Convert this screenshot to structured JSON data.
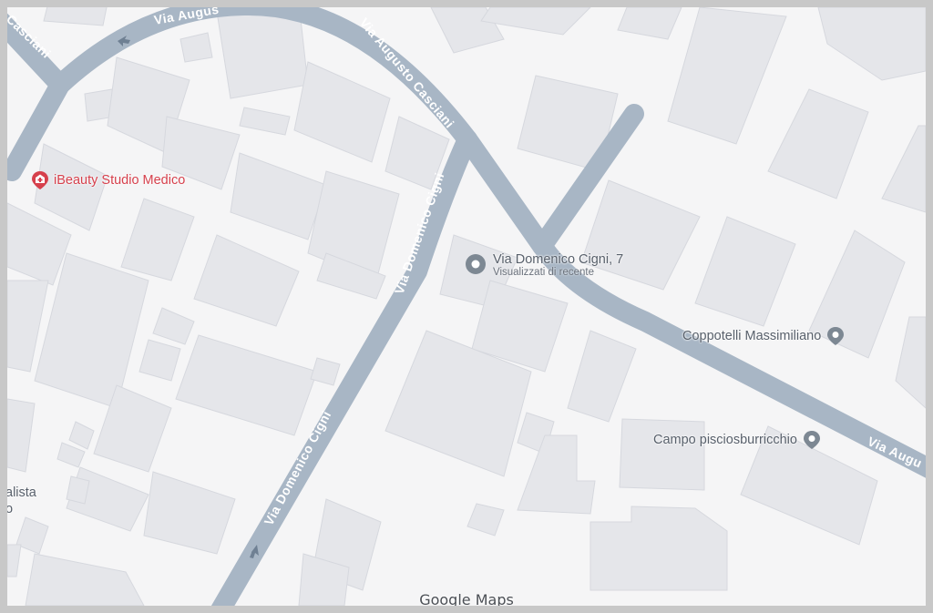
{
  "map": {
    "streets": {
      "via_augusto_casciani_top": "Via Augus",
      "via_augusto_casciani_left": "Casciani",
      "via_augusto_casciani_diag": "Via Augusto Casciani",
      "via_domenico_cigni_upper": "Via Domenico Cigni",
      "via_domenico_cigni_lower": "Via Domenico Cigni",
      "via_augusto_right": "Via Augu"
    },
    "places": {
      "ibeauty": {
        "name": "iBeauty Studio Medico",
        "icon": "medical-pin-icon",
        "color": "#d6404c"
      },
      "selected": {
        "name": "Via Domenico Cigni, 7",
        "subtitle": "Visualizzati di recente",
        "icon": "location-pin-icon"
      },
      "coppotelli": {
        "name": "Coppotelli Massimiliano",
        "icon": "location-pin-icon"
      },
      "campo": {
        "name": "Campo pisciosburricchio",
        "icon": "location-pin-icon"
      },
      "partial_left": {
        "line1": "alista",
        "line2": "o"
      }
    },
    "colors": {
      "road": "#a8b6c5",
      "building": "#e5e6ea",
      "background": "#f5f5f6",
      "pin": "#7d8893"
    },
    "watermark": {
      "brand": "Google",
      "product": "Maps"
    }
  }
}
